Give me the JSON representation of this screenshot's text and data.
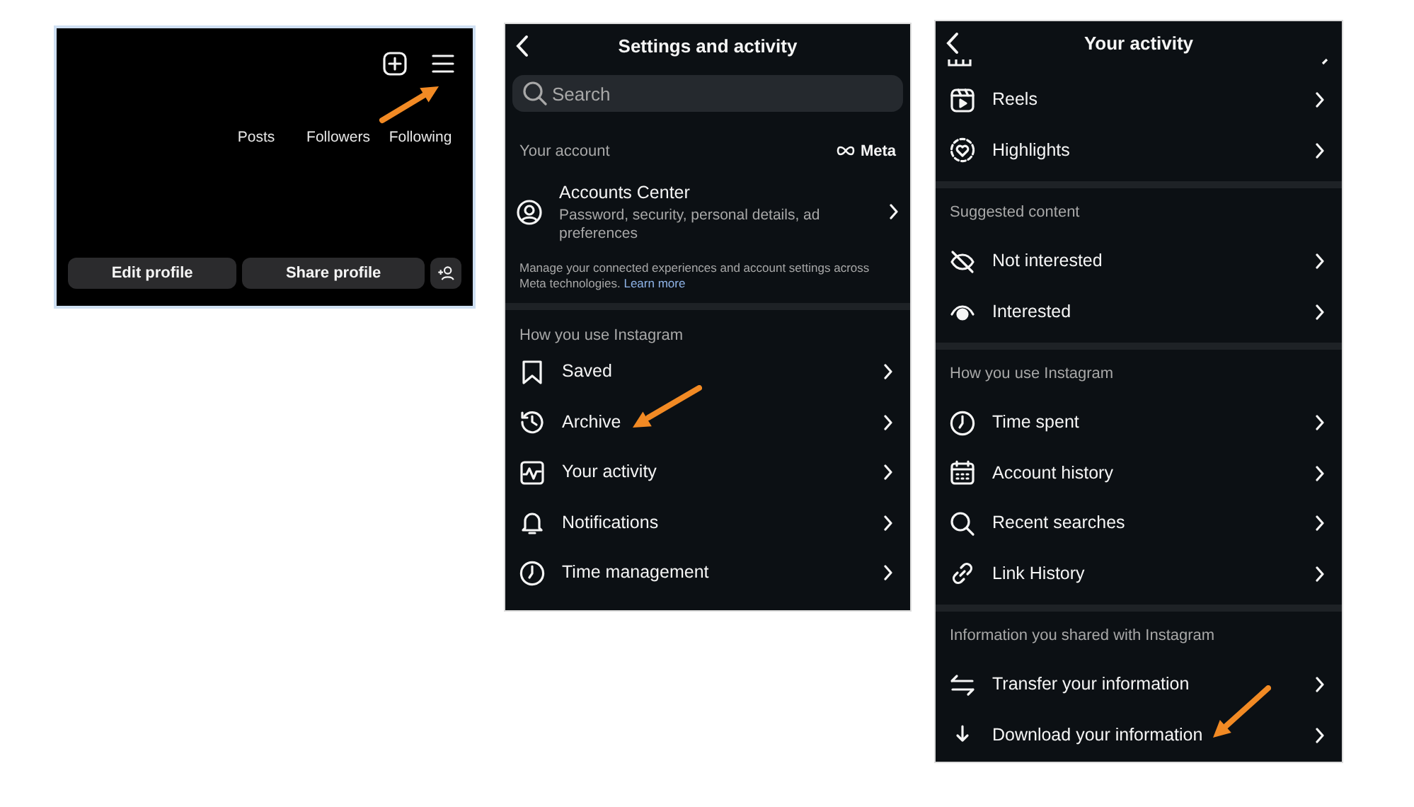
{
  "profile_panel": {
    "stats": [
      "Posts",
      "Followers",
      "Following"
    ],
    "buttons": [
      "Edit profile",
      "Share profile"
    ]
  },
  "settings_panel": {
    "title": "Settings and activity",
    "search": {
      "placeholder": "Search"
    },
    "sections": [
      {
        "heading": "Your account",
        "brand": "Meta",
        "items": [
          {
            "label": "Accounts Center",
            "description": "Password, security, personal details, ad preferences"
          }
        ],
        "note": "Manage your connected experiences and account settings across Meta technologies.",
        "note_link": "Learn more"
      },
      {
        "heading": "How you use Instagram",
        "items": [
          {
            "label": "Saved"
          },
          {
            "label": "Archive"
          },
          {
            "label": "Your activity"
          },
          {
            "label": "Notifications"
          },
          {
            "label": "Time management"
          }
        ]
      }
    ]
  },
  "activity_panel": {
    "title": "Your activity",
    "clipped_top": true,
    "sections": [
      {
        "items": [
          {
            "label": "Reels"
          },
          {
            "label": "Highlights"
          }
        ]
      },
      {
        "heading": "Suggested content",
        "items": [
          {
            "label": "Not interested"
          },
          {
            "label": "Interested"
          }
        ]
      },
      {
        "heading": "How you use Instagram",
        "items": [
          {
            "label": "Time spent"
          },
          {
            "label": "Account history"
          },
          {
            "label": "Recent searches"
          },
          {
            "label": "Link History"
          }
        ]
      },
      {
        "heading": "Information you shared with Instagram",
        "items": [
          {
            "label": "Transfer your information"
          },
          {
            "label": "Download your information"
          }
        ]
      }
    ]
  }
}
